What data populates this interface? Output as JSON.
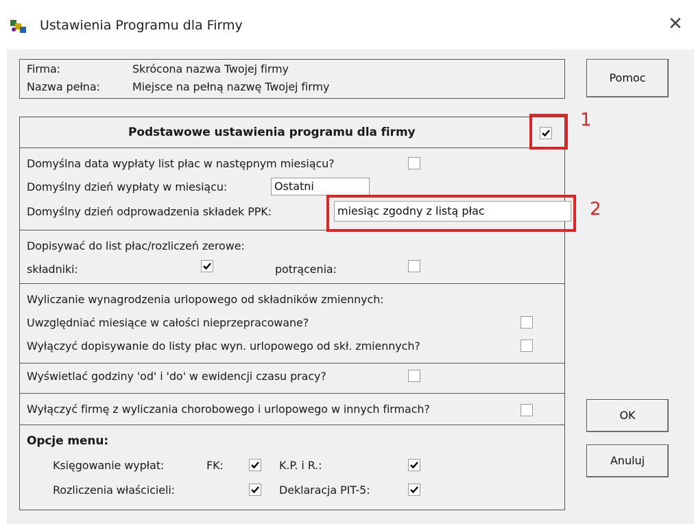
{
  "window": {
    "title": "Ustawienia Programu dla Firmy",
    "close_glyph": "✕"
  },
  "firm": {
    "firma_label": "Firma:",
    "firma_value": "Skrócona nazwa Twojej firmy",
    "nazwa_label": "Nazwa pełna:",
    "nazwa_value": "Miejsce na pełną nazwę Twojej firmy"
  },
  "buttons": {
    "pomoc": "Pomoc",
    "ok": "OK",
    "anuluj": "Anuluj"
  },
  "settings": {
    "header": "Podstawowe ustawienia programu dla firmy",
    "header_checked": true,
    "default_date_label": "Domyślna data wypłaty list płac w następnym miesiącu?",
    "default_date_checked": false,
    "default_day_label": "Domyślny dzień wypłaty w miesiącu:",
    "default_day_value": "Ostatni",
    "ppk_label": "Domyślny dzień odprowadzenia składek PPK:",
    "ppk_value": "miesiąc zgodny z listą płac",
    "zero_label": "Dopisywać do list płac/rozliczeń zerowe:",
    "skladniki_label": "składniki:",
    "skladniki_checked": true,
    "potracenia_label": "potrącenia:",
    "potracenia_checked": false,
    "urlop_heading": "Wyliczanie wynagrodzenia urlopowego od składników zmiennych:",
    "urlop_months_label": "Uwzględniać miesiące w całości nieprzepracowane?",
    "urlop_months_checked": false,
    "urlop_disable_label": "Wyłączyć dopisywanie do listy płac wyn. urlopowego od skł. zmiennych?",
    "urlop_disable_checked": false,
    "hours_label": "Wyświetlać godziny 'od' i 'do' w ewidencji czasu pracy?",
    "hours_checked": false,
    "exclude_label": "Wyłączyć firmę z wyliczania chorobowego i urlopowego w innych firmach?",
    "exclude_checked": false
  },
  "menu_options": {
    "heading": "Opcje menu:",
    "ksiegowanie_label": "Księgowanie wypłat:",
    "fk_label": "FK:",
    "fk_checked": true,
    "kpir_label": "K.P. i R.:",
    "kpir_checked": true,
    "rozliczenia_label": "Rozliczenia właścicieli:",
    "rozliczenia_checked": true,
    "pit5_label": "Deklaracja PIT-5:",
    "pit5_checked": true
  },
  "callouts": {
    "one": "1",
    "two": "2"
  },
  "colors": {
    "callout": "#e02424",
    "dialog_bg": "#f0f0f0"
  }
}
